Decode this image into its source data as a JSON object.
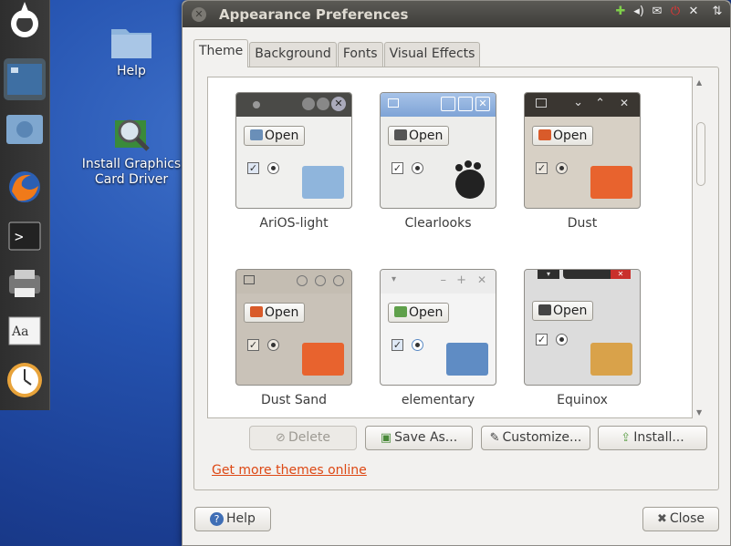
{
  "desktop": {
    "icons": [
      {
        "label": "Help"
      },
      {
        "label_line1": "Install Graphics",
        "label_line2": "Card Driver"
      }
    ]
  },
  "launcher": {
    "items": [
      "ubuntu-logo-icon",
      "workspace-switcher-icon",
      "home-folder-icon",
      "firefox-icon",
      "terminal-icon",
      "printer-icon",
      "font-viewer-icon",
      "clock-icon"
    ]
  },
  "window": {
    "title": "Appearance Preferences",
    "tabs": [
      {
        "label": "Theme",
        "active": true
      },
      {
        "label": "Background",
        "active": false
      },
      {
        "label": "Fonts",
        "active": false
      },
      {
        "label": "Visual Effects",
        "active": false
      }
    ],
    "themes": [
      {
        "name": "AriOS-light",
        "preview_button": "Open",
        "titlebar_color": "#4a4a47",
        "body_color": "#f0f0ee"
      },
      {
        "name": "Clearlooks",
        "preview_button": "Open",
        "titlebar_color": "#8fb0dd",
        "body_color": "#ededeb"
      },
      {
        "name": "Dust",
        "preview_button": "Open",
        "titlebar_color": "#3a3631",
        "body_color": "#d7d0c5"
      },
      {
        "name": "Dust Sand",
        "preview_button": "Open",
        "titlebar_color": "#c4bdb2",
        "body_color": "#c9c2b8"
      },
      {
        "name": "elementary",
        "preview_button": "Open",
        "titlebar_color": "#ececec",
        "body_color": "#f4f4f4"
      },
      {
        "name": "Equinox",
        "preview_button": "Open",
        "titlebar_color": "#2e2e2e",
        "body_color": "#dcdcdc"
      }
    ],
    "buttons": {
      "delete": "Delete",
      "save_as": "Save As...",
      "customize": "Customize...",
      "install": "Install..."
    },
    "link": "Get more themes online",
    "footer": {
      "help": "Help",
      "close": "Close"
    }
  },
  "colors": {
    "accent": "#dd4814",
    "titlebar": "#3e3d39",
    "window_bg": "#f2f1ef"
  }
}
